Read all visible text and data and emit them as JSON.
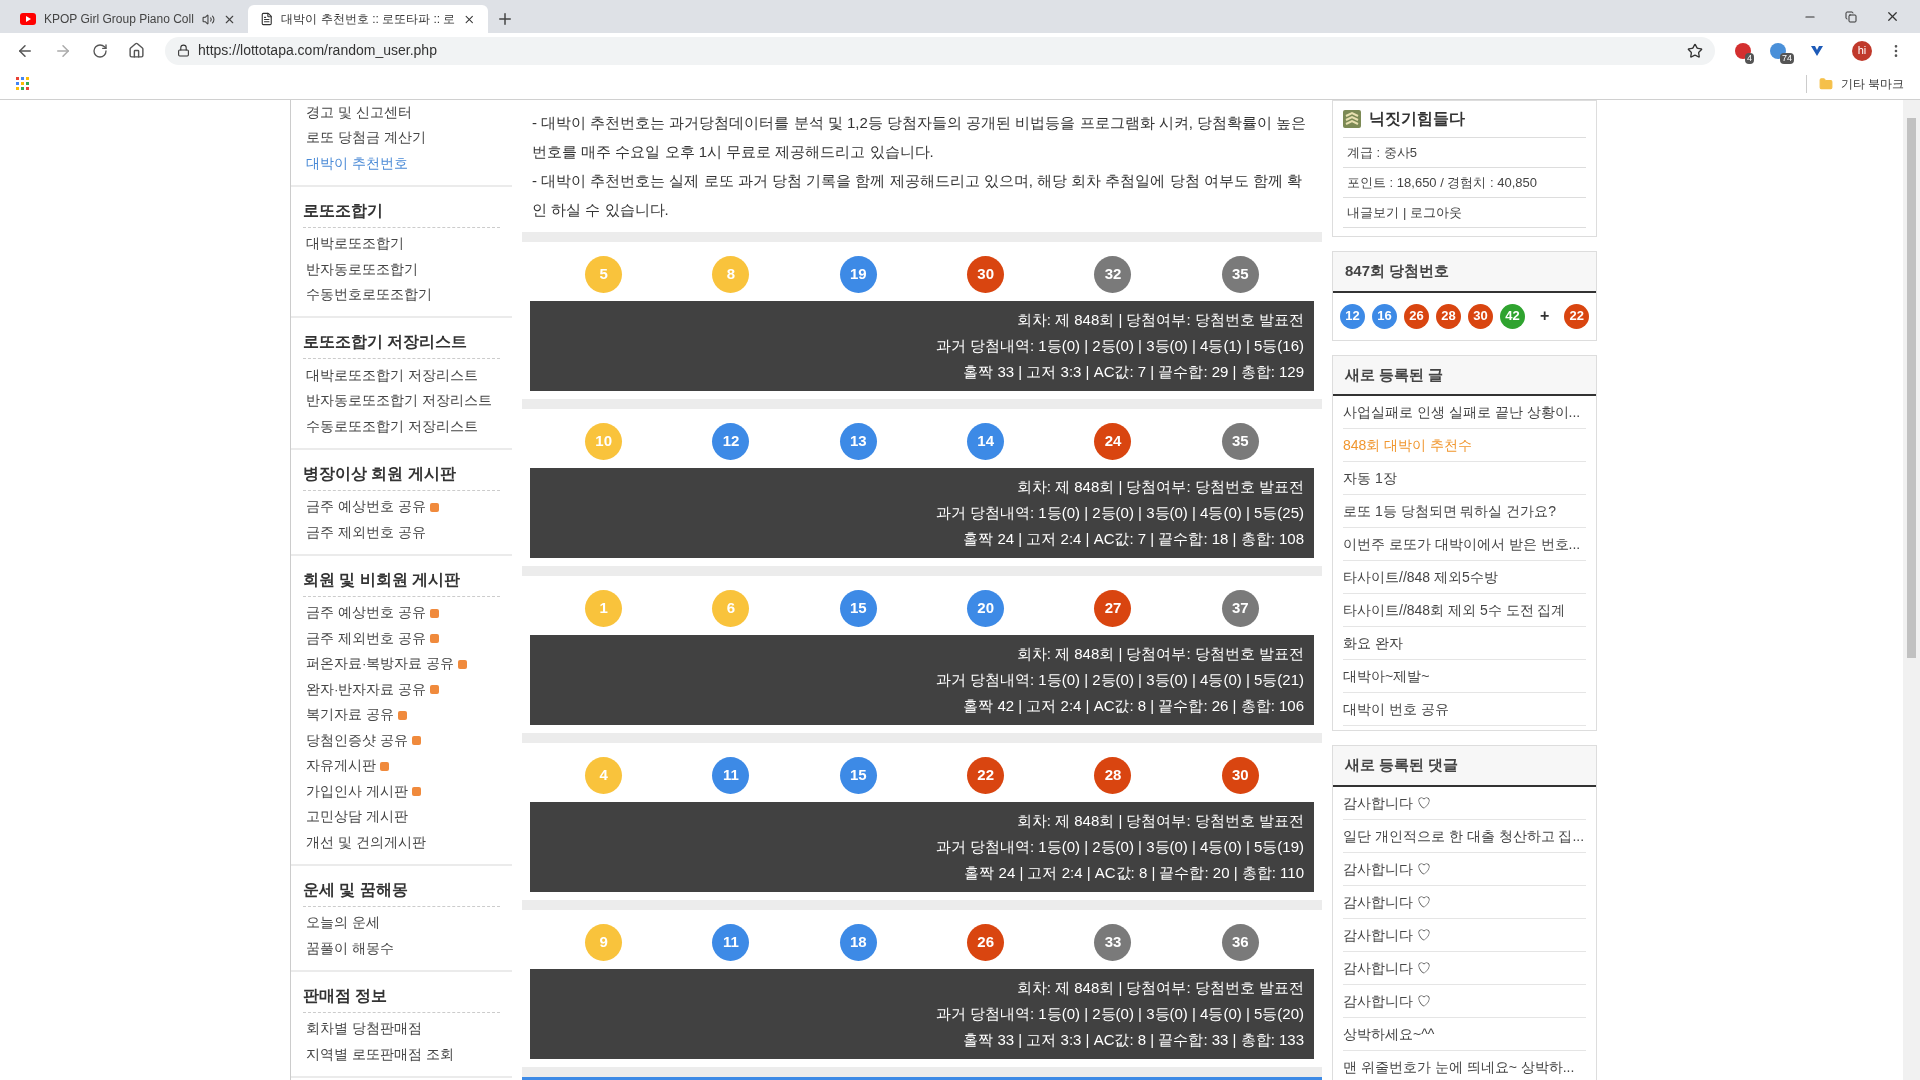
{
  "browser": {
    "tabs": [
      {
        "title": "KPOP Girl Group Piano Coll",
        "selected": false,
        "kind": "video"
      },
      {
        "title": "대박이 추천번호 :: 로또타파 :: 로",
        "selected": true,
        "kind": "page"
      }
    ],
    "url": "https://lottotapa.com/random_user.php",
    "extension_badges": [
      "4",
      "74"
    ],
    "profile": "hi",
    "bookmarks_folder": "기타 북마크"
  },
  "sidebar": [
    {
      "items": [
        {
          "label": "경고 및 신고센터",
          "selected": false,
          "new": false
        },
        {
          "label": "로또 당첨금 계산기",
          "selected": false,
          "new": false
        },
        {
          "label": "대박이 추천번호",
          "selected": true,
          "new": false
        }
      ]
    },
    {
      "title": "로또조합기",
      "items": [
        {
          "label": "대박로또조합기",
          "selected": false,
          "new": false
        },
        {
          "label": "반자동로또조합기",
          "selected": false,
          "new": false
        },
        {
          "label": "수동번호로또조합기",
          "selected": false,
          "new": false
        }
      ]
    },
    {
      "title": "로또조합기 저장리스트",
      "items": [
        {
          "label": "대박로또조합기 저장리스트",
          "selected": false,
          "new": false
        },
        {
          "label": "반자동로또조합기 저장리스트",
          "selected": false,
          "new": false
        },
        {
          "label": "수동로또조합기 저장리스트",
          "selected": false,
          "new": false
        }
      ]
    },
    {
      "title": "병장이상 회원 게시판",
      "items": [
        {
          "label": "금주 예상번호 공유",
          "selected": false,
          "new": true
        },
        {
          "label": "금주 제외번호 공유",
          "selected": false,
          "new": false
        }
      ]
    },
    {
      "title": "회원 및 비회원 게시판",
      "items": [
        {
          "label": "금주 예상번호 공유",
          "selected": false,
          "new": true
        },
        {
          "label": "금주 제외번호 공유",
          "selected": false,
          "new": true
        },
        {
          "label": "퍼온자료·복방자료 공유",
          "selected": false,
          "new": true
        },
        {
          "label": "완자·반자자료 공유",
          "selected": false,
          "new": true
        },
        {
          "label": "복기자료 공유",
          "selected": false,
          "new": true
        },
        {
          "label": "당첨인증샷 공유",
          "selected": false,
          "new": true
        },
        {
          "label": "자유게시판",
          "selected": false,
          "new": true
        },
        {
          "label": "가입인사 게시판",
          "selected": false,
          "new": true
        },
        {
          "label": "고민상담 게시판",
          "selected": false,
          "new": false
        },
        {
          "label": "개선 및 건의게시판",
          "selected": false,
          "new": false
        }
      ]
    },
    {
      "title": "운세 및 꿈해몽",
      "items": [
        {
          "label": "오늘의 운세",
          "selected": false,
          "new": false
        },
        {
          "label": "꿈풀이 해몽수",
          "selected": false,
          "new": false
        }
      ]
    },
    {
      "title": "판매점 정보",
      "items": [
        {
          "label": "회차별 당첨판매점",
          "selected": false,
          "new": false
        },
        {
          "label": "지역별 로또판매점 조회",
          "selected": false,
          "new": false
        }
      ]
    }
  ],
  "intro": [
    "- 대박이 추천번호는 과거당첨데이터를 분석 및 1,2등 당첨자들의 공개된 비법등을 프로그램화 시켜, 당첨확률이 높은 번호를 매주 수요일 오후 1시 무료로 제공해드리고 있습니다.",
    "- 대박이 추천번호는 실제 로또 과거 당첨 기록을 함께 제공해드리고 있으며, 해당 회차 추첨일에 당첨 여부도 함께 확인 하실 수 있습니다."
  ],
  "results": [
    {
      "balls": [
        {
          "number": "5",
          "color": "#f9c33c"
        },
        {
          "number": "8",
          "color": "#f9c33c"
        },
        {
          "number": "19",
          "color": "#3d8ae6"
        },
        {
          "number": "30",
          "color": "#d94510"
        },
        {
          "number": "32",
          "color": "#7a7a7a"
        },
        {
          "number": "35",
          "color": "#7a7a7a"
        }
      ],
      "lines": [
        "회차: 제 848회 | 당첨여부: 당첨번호 발표전",
        "과거 당첨내역: 1등(0) | 2등(0) | 3등(0) | 4등(1) | 5등(16)",
        "홀짝 33 | 고저 3:3 | AC값: 7 | 끝수합: 29 | 총합: 129"
      ]
    },
    {
      "balls": [
        {
          "number": "10",
          "color": "#f9c33c"
        },
        {
          "number": "12",
          "color": "#3d8ae6"
        },
        {
          "number": "13",
          "color": "#3d8ae6"
        },
        {
          "number": "14",
          "color": "#3d8ae6"
        },
        {
          "number": "24",
          "color": "#d94510"
        },
        {
          "number": "35",
          "color": "#7a7a7a"
        }
      ],
      "lines": [
        "회차: 제 848회 | 당첨여부: 당첨번호 발표전",
        "과거 당첨내역: 1등(0) | 2등(0) | 3등(0) | 4등(0) | 5등(25)",
        "홀짝 24 | 고저 2:4 | AC값: 7 | 끝수합: 18 | 총합: 108"
      ]
    },
    {
      "balls": [
        {
          "number": "1",
          "color": "#f9c33c"
        },
        {
          "number": "6",
          "color": "#f9c33c"
        },
        {
          "number": "15",
          "color": "#3d8ae6"
        },
        {
          "number": "20",
          "color": "#3d8ae6"
        },
        {
          "number": "27",
          "color": "#d94510"
        },
        {
          "number": "37",
          "color": "#7a7a7a"
        }
      ],
      "lines": [
        "회차: 제 848회 | 당첨여부: 당첨번호 발표전",
        "과거 당첨내역: 1등(0) | 2등(0) | 3등(0) | 4등(0) | 5등(21)",
        "홀짝 42 | 고저 2:4 | AC값: 8 | 끝수합: 26 | 총합: 106"
      ]
    },
    {
      "balls": [
        {
          "number": "4",
          "color": "#f9c33c"
        },
        {
          "number": "11",
          "color": "#3d8ae6"
        },
        {
          "number": "15",
          "color": "#3d8ae6"
        },
        {
          "number": "22",
          "color": "#d94510"
        },
        {
          "number": "28",
          "color": "#d94510"
        },
        {
          "number": "30",
          "color": "#d94510"
        }
      ],
      "lines": [
        "회차: 제 848회 | 당첨여부: 당첨번호 발표전",
        "과거 당첨내역: 1등(0) | 2등(0) | 3등(0) | 4등(0) | 5등(19)",
        "홀짝 24 | 고저 2:4 | AC값: 8 | 끝수합: 20 | 총합: 110"
      ]
    },
    {
      "balls": [
        {
          "number": "9",
          "color": "#f9c33c"
        },
        {
          "number": "11",
          "color": "#3d8ae6"
        },
        {
          "number": "18",
          "color": "#3d8ae6"
        },
        {
          "number": "26",
          "color": "#d94510"
        },
        {
          "number": "33",
          "color": "#7a7a7a"
        },
        {
          "number": "36",
          "color": "#7a7a7a"
        }
      ],
      "lines": [
        "회차: 제 848회 | 당첨여부: 당첨번호 발표전",
        "과거 당첨내역: 1등(0) | 2등(0) | 3등(0) | 4등(0) | 5등(20)",
        "홀짝 33 | 고저 3:3 | AC값: 8 | 끝수합: 33 | 총합: 133"
      ]
    }
  ],
  "user": {
    "nickname": "닉짓기힘들다",
    "rank": "계급 : 중사5",
    "points": "포인트 : 18,650 / 경험치 : 40,850",
    "links": [
      "내글보기",
      "로그아웃"
    ],
    "separator": "|"
  },
  "last_draw": {
    "title": "847회 당첨번호",
    "balls": [
      {
        "number": "12",
        "color": "#3d8ae6"
      },
      {
        "number": "16",
        "color": "#3d8ae6"
      },
      {
        "number": "26",
        "color": "#d94510"
      },
      {
        "number": "28",
        "color": "#d94510"
      },
      {
        "number": "30",
        "color": "#d94510"
      },
      {
        "number": "42",
        "color": "#2fa32f"
      }
    ],
    "plus": "+",
    "bonus": {
      "number": "22",
      "color": "#d94510"
    }
  },
  "new_posts": {
    "title": "새로 등록된 글",
    "items": [
      {
        "text": "사업실패로 인생 실패로 끝난 상황이...",
        "highlighted": false
      },
      {
        "text": "848회 대박이 추천수",
        "highlighted": true
      },
      {
        "text": "자동 1장",
        "highlighted": false
      },
      {
        "text": "로또 1등 당첨되면 뭐하실 건가요?",
        "highlighted": false
      },
      {
        "text": "이번주 로또가 대박이에서 받은 번호...",
        "highlighted": false
      },
      {
        "text": "타사이트//848 제외5수방",
        "highlighted": false
      },
      {
        "text": "타사이트//848회 제외 5수 도전 집계",
        "highlighted": false
      },
      {
        "text": "화요 완자",
        "highlighted": false
      },
      {
        "text": "대박아~제발~",
        "highlighted": false
      },
      {
        "text": "대박이 번호 공유",
        "highlighted": false
      }
    ]
  },
  "new_comments": {
    "title": "새로 등록된 댓글",
    "items": [
      {
        "text": "감사합니다 ♡",
        "highlighted": false
      },
      {
        "text": "일단 개인적으로 한 대출 청산하고 집...",
        "highlighted": false
      },
      {
        "text": "감사합니다 ♡",
        "highlighted": false
      },
      {
        "text": "감사합니다 ♡",
        "highlighted": false
      },
      {
        "text": "감사합니다 ♡",
        "highlighted": false
      },
      {
        "text": "감사합니다 ♡",
        "highlighted": false
      },
      {
        "text": "감사합니다 ♡",
        "highlighted": false
      },
      {
        "text": "상박하세요~^^",
        "highlighted": false
      },
      {
        "text": "맨 위줄번호가 눈에 띄네요~ 상박하...",
        "highlighted": false
      }
    ]
  }
}
